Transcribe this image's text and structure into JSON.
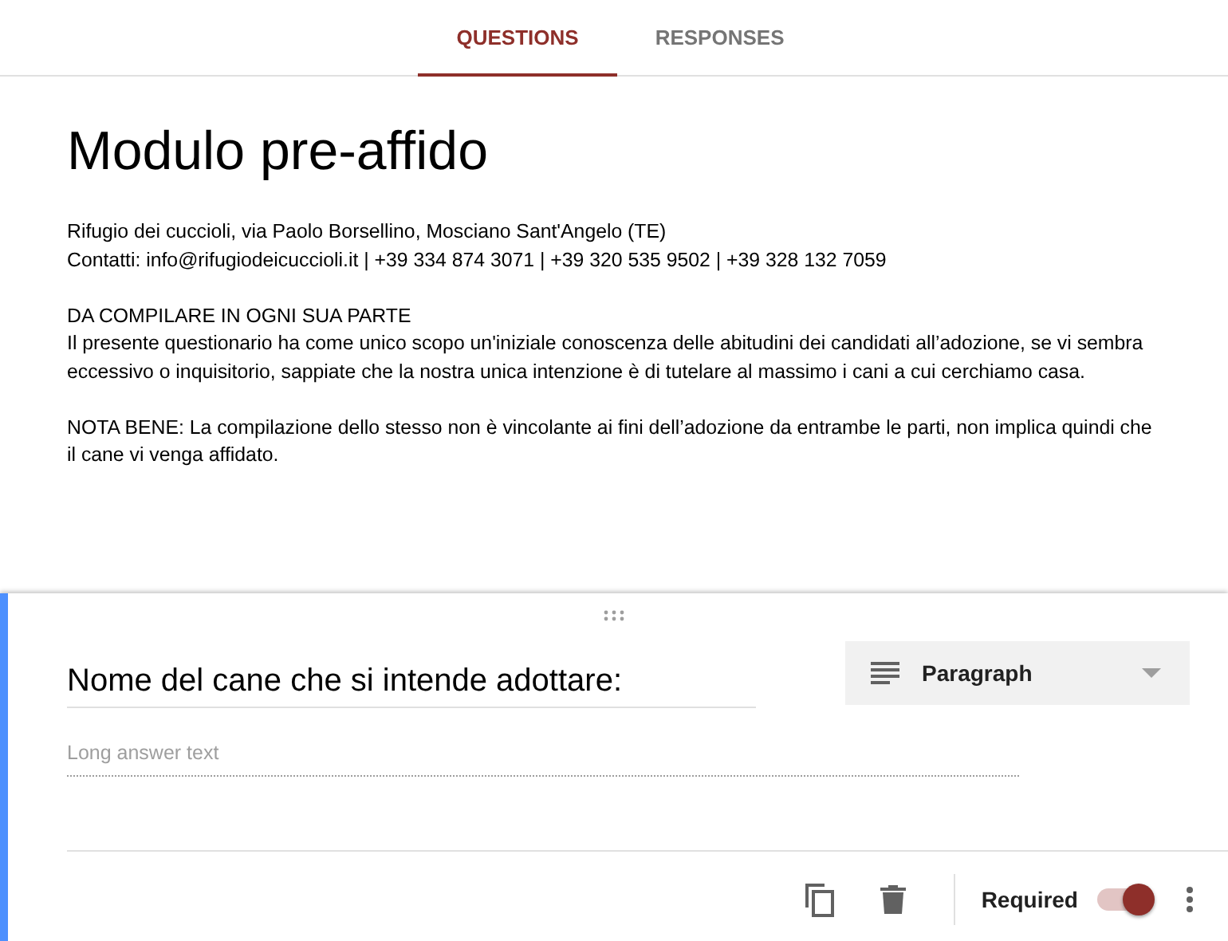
{
  "tabs": [
    {
      "label": "QUESTIONS",
      "selected": true
    },
    {
      "label": "RESPONSES",
      "selected": false
    }
  ],
  "form": {
    "title": "Modulo pre-affido",
    "description": [
      {
        "lines": [
          "Rifugio dei cuccioli, via Paolo Borsellino, Mosciano Sant'Angelo (TE)",
          "Contatti: info@rifugiodeicuccioli.it | +39 334 874 3071 | +39 320 535 9502 | +39 328 132 7059"
        ]
      },
      {
        "lines": [
          "DA COMPILARE IN OGNI SUA PARTE",
          "Il presente questionario ha come unico scopo un'iniziale conoscenza delle abitudini dei candidati all’adozione, se vi sembra eccessivo o inquisitorio, sappiate che la nostra unica intenzione è di tutelare al massimo i cani a cui cerchiamo casa."
        ]
      },
      {
        "lines": [
          "NOTA BENE: La compilazione dello stesso non è vincolante ai fini dell’adozione da entrambe le parti, non implica quindi che il cane vi venga affidato."
        ]
      }
    ]
  },
  "question": {
    "title": "Nome del cane che si intende adottare:",
    "type": "Paragraph",
    "placeholder": "Long answer text",
    "required_label": "Required",
    "required": true
  }
}
